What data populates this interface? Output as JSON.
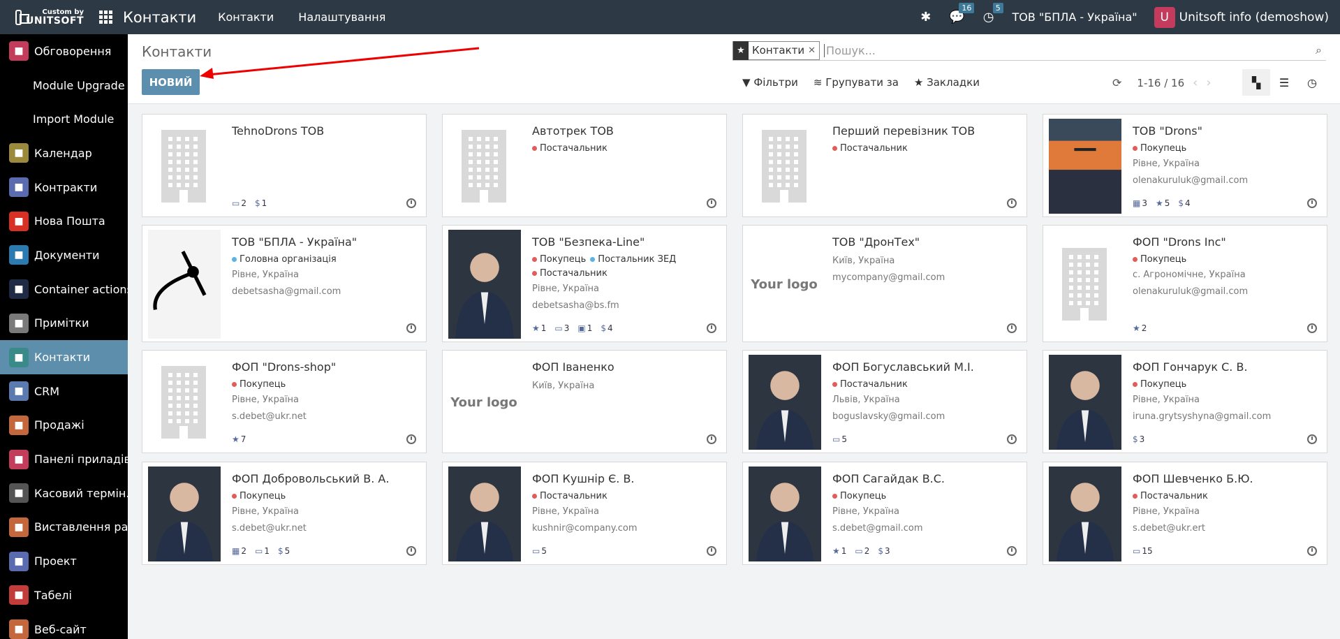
{
  "brand": {
    "top": "Custom by",
    "name": "UNITSOFT"
  },
  "app_name": "Контакти",
  "top_menu": [
    "Контакти",
    "Налаштування"
  ],
  "badges": {
    "messages": "16",
    "activities": "5"
  },
  "company": "ТОВ \"БПЛА - Україна\"",
  "user": {
    "initial": "U",
    "name": "Unitsoft info (demoshow)"
  },
  "sidebar": {
    "items": [
      {
        "label": "Обговорення",
        "icon": "chat-icon",
        "color": "#c33c5c"
      },
      {
        "label": "Module Upgrade",
        "icon": "",
        "color": ""
      },
      {
        "label": "Import Module",
        "icon": "",
        "color": ""
      },
      {
        "label": "Календар",
        "icon": "calendar-icon",
        "color": "#9c8a3c"
      },
      {
        "label": "Контракти",
        "icon": "contract-icon",
        "color": "#5a6bb0"
      },
      {
        "label": "Нова Пошта",
        "icon": "nova-poshta-icon",
        "color": "#d93025"
      },
      {
        "label": "Документи",
        "icon": "documents-icon",
        "color": "#2b7bb0"
      },
      {
        "label": "Container actions",
        "icon": "container-icon",
        "color": "#1f2a44"
      },
      {
        "label": "Примітки",
        "icon": "notes-icon",
        "color": "#7a7a7a"
      },
      {
        "label": "Контакти",
        "icon": "contacts-icon",
        "color": "#3a8a8a"
      },
      {
        "label": "CRM",
        "icon": "crm-icon",
        "color": "#5a7ab0"
      },
      {
        "label": "Продажі",
        "icon": "sales-icon",
        "color": "#c4673c"
      },
      {
        "label": "Панелі приладів",
        "icon": "dashboard-icon",
        "color": "#c33c5c"
      },
      {
        "label": "Касовий термін...",
        "icon": "pos-icon",
        "color": "#555"
      },
      {
        "label": "Виставлення ра...",
        "icon": "invoice-icon",
        "color": "#c4673c"
      },
      {
        "label": "Проект",
        "icon": "project-icon",
        "color": "#5a6bb0"
      },
      {
        "label": "Табелі",
        "icon": "timesheet-icon",
        "color": "#c33c3c"
      },
      {
        "label": "Веб-сайт",
        "icon": "website-icon",
        "color": "#c4673c"
      }
    ]
  },
  "control": {
    "title": "Контакти",
    "new_button": "НОВИЙ",
    "facet": "Контакти",
    "search_placeholder": "Пошук...",
    "filters": "Фільтри",
    "group_by": "Групувати за",
    "favorites": "Закладки",
    "pager": "1-16 / 16"
  },
  "cards": [
    {
      "title": "TehnoDrons ТОВ",
      "img": "building",
      "tags": [],
      "location": "",
      "email": "",
      "stats": [
        {
          "icon": "card-icon",
          "v": "2"
        },
        {
          "icon": "dollar-icon",
          "v": "1"
        }
      ]
    },
    {
      "title": "Автотрек ТОВ",
      "img": "building",
      "tags": [
        {
          "t": "Постачальник",
          "c": "red"
        }
      ],
      "location": "",
      "email": "",
      "stats": []
    },
    {
      "title": "Перший перевізник ТОВ",
      "img": "building",
      "tags": [
        {
          "t": "Постачальник",
          "c": "red"
        }
      ],
      "location": "",
      "email": "",
      "stats": []
    },
    {
      "title": "ТОВ \"Drons\"",
      "img": "drone-photo",
      "tags": [
        {
          "t": "Покупець",
          "c": "red"
        }
      ],
      "location": "Рівне, Україна",
      "email": "olenakuruluk@gmail.com",
      "stats": [
        {
          "icon": "calendar-icon",
          "v": "3"
        },
        {
          "icon": "star-icon",
          "v": "5"
        },
        {
          "icon": "dollar-icon",
          "v": "4"
        }
      ]
    },
    {
      "title": "ТОВ \"БПЛА - Україна\"",
      "img": "swoosh-logo",
      "tags": [
        {
          "t": "Головна організація",
          "c": "blue"
        }
      ],
      "location": "Рівне, Україна",
      "email": "debetsasha@gmail.com",
      "stats": []
    },
    {
      "title": "ТОВ \"Безпека-Line\"",
      "img": "person-photo",
      "tags": [
        {
          "t": "Покупець",
          "c": "red"
        },
        {
          "t": "Постальник ЗЕД",
          "c": "blue"
        },
        {
          "t": "Постачальник",
          "c": "red"
        }
      ],
      "location": "Рівне, Україна",
      "email": "debetsasha@bs.fm",
      "stats": [
        {
          "icon": "star-icon",
          "v": "1"
        },
        {
          "icon": "card-icon",
          "v": "3"
        },
        {
          "icon": "briefcase-icon",
          "v": "1"
        },
        {
          "icon": "dollar-icon",
          "v": "4"
        }
      ]
    },
    {
      "title": "ТОВ \"ДронТех\"",
      "img": "your-logo",
      "tags": [],
      "location": "Київ, Україна",
      "email": "mycompany@gmail.com",
      "stats": []
    },
    {
      "title": "ФОП \"Drons Inc\"",
      "img": "building",
      "tags": [
        {
          "t": "Покупець",
          "c": "red"
        }
      ],
      "location": "с. Агрономічне, Україна",
      "email": "olenakuruluk@gmail.com",
      "stats": [
        {
          "icon": "star-icon",
          "v": "2"
        }
      ]
    },
    {
      "title": "ФОП \"Drons-shop\"",
      "img": "building",
      "tags": [
        {
          "t": "Покупець",
          "c": "red"
        }
      ],
      "location": "Рівне, Україна",
      "email": "s.debet@ukr.net",
      "stats": [
        {
          "icon": "star-icon",
          "v": "7"
        }
      ]
    },
    {
      "title": "ФОП Іваненко",
      "img": "your-logo",
      "tags": [],
      "location": "Київ, Україна",
      "email": "",
      "stats": []
    },
    {
      "title": "ФОП Богуславський М.І.",
      "img": "person-photo",
      "tags": [
        {
          "t": "Постачальник",
          "c": "red"
        }
      ],
      "location": "Львів, Україна",
      "email": "boguslavsky@gmail.com",
      "stats": [
        {
          "icon": "card-icon",
          "v": "5"
        }
      ]
    },
    {
      "title": "ФОП Гончарук С. В.",
      "img": "person-photo",
      "tags": [
        {
          "t": "Покупець",
          "c": "red"
        }
      ],
      "location": "Рівне, Україна",
      "email": "iruna.grytsyshyna@gmail.com",
      "stats": [
        {
          "icon": "dollar-icon",
          "v": "3"
        }
      ]
    },
    {
      "title": "ФОП Добровольський В. А.",
      "img": "person-photo",
      "tags": [
        {
          "t": "Покупець",
          "c": "red"
        }
      ],
      "location": "Рівне, Україна",
      "email": "s.debet@ukr.net",
      "stats": [
        {
          "icon": "calendar-icon",
          "v": "2"
        },
        {
          "icon": "card-icon",
          "v": "1"
        },
        {
          "icon": "dollar-icon",
          "v": "5"
        }
      ]
    },
    {
      "title": "ФОП Кушнір Є. В.",
      "img": "person-photo",
      "tags": [
        {
          "t": "Постачальник",
          "c": "red"
        }
      ],
      "location": "Рівне, Україна",
      "email": "kushnir@company.com",
      "stats": [
        {
          "icon": "card-icon",
          "v": "5"
        }
      ]
    },
    {
      "title": "ФОП Сагайдак В.С.",
      "img": "person-photo",
      "tags": [
        {
          "t": "Покупець",
          "c": "red"
        }
      ],
      "location": "Рівне, Україна",
      "email": "s.debet@gmail.com",
      "stats": [
        {
          "icon": "star-icon",
          "v": "1"
        },
        {
          "icon": "card-icon",
          "v": "2"
        },
        {
          "icon": "dollar-icon",
          "v": "3"
        }
      ]
    },
    {
      "title": "ФОП Шевченко Б.Ю.",
      "img": "person-photo",
      "tags": [
        {
          "t": "Постачальник",
          "c": "red"
        }
      ],
      "location": "Рівне, Україна",
      "email": "s.debet@ukr.ert",
      "stats": [
        {
          "icon": "card-icon",
          "v": "15"
        }
      ]
    }
  ],
  "your_logo_text": "Your logo"
}
